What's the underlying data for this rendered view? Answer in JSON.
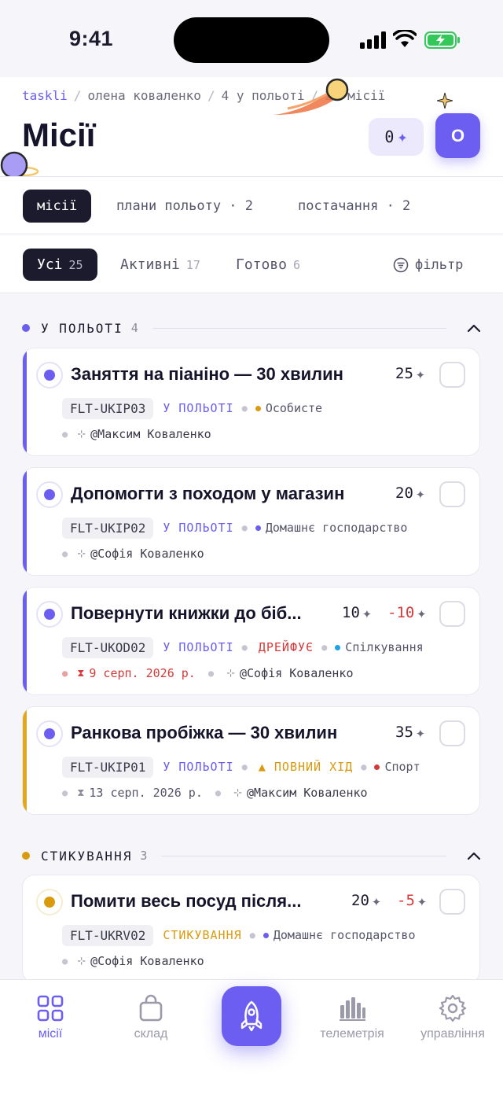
{
  "status_bar": {
    "time": "9:41"
  },
  "breadcrumb": {
    "brand": "taskli",
    "user": "олена коваленко",
    "in_flight": "4 у польоті",
    "missions": "25 місії"
  },
  "header": {
    "title": "Місії",
    "points": "0",
    "points_icon": "spark-icon",
    "avatar_letter": "О"
  },
  "tabs": [
    {
      "label": "місії",
      "active": true
    },
    {
      "label": "плани польоту · 2",
      "active": false
    },
    {
      "label": "постачання · 2",
      "active": false
    }
  ],
  "filters": {
    "all": {
      "label": "Усі",
      "count": "25"
    },
    "active": {
      "label": "Активні",
      "count": "17"
    },
    "done": {
      "label": "Готово",
      "count": "6"
    },
    "filter_label": "фільтр"
  },
  "sections": {
    "flight": {
      "label": "У ПОЛЬОТІ",
      "count": "4",
      "color": "#6b5ef0"
    },
    "dock": {
      "label": "СТИКУВАННЯ",
      "count": "3",
      "color": "#d99a10"
    }
  },
  "cards": [
    {
      "title": "Заняття на піаніно — 30 хвилин",
      "points": "25",
      "code": "FLT-UKIP03",
      "status": "У ПОЛЬОТІ",
      "category": "Особисте",
      "category_color": "#d99a10",
      "assignee": "@Максим Коваленко"
    },
    {
      "title": "Допомогти з походом у магазин",
      "points": "20",
      "code": "FLT-UKIP02",
      "status": "У ПОЛЬОТІ",
      "category": "Домашнє господарство",
      "category_color": "#6b5ef0",
      "assignee": "@Софія Коваленко"
    },
    {
      "title": "Повернути книжки до біб...",
      "points": "10",
      "penalty": "-10",
      "code": "FLT-UKOD02",
      "status": "У ПОЛЬОТІ",
      "flag": "ДРЕЙФУЄ",
      "category": "Спілкування",
      "category_color": "#1aa3e8",
      "due": "9 серп. 2026 р.",
      "assignee": "@Софія Коваленко"
    },
    {
      "title": "Ранкова пробіжка — 30 хвилин",
      "points": "35",
      "code": "FLT-UKIP01",
      "status": "У ПОЛЬОТІ",
      "flag": "▲ ПОВНИЙ ХІД",
      "category": "Спорт",
      "category_color": "#d43a3a",
      "due": "13 серп. 2026 р.",
      "assignee": "@Максим Коваленко"
    },
    {
      "title": "Помити весь посуд після...",
      "points": "20",
      "penalty": "-5",
      "code": "FLT-UKRV02",
      "status": "СТИКУВАННЯ",
      "category": "Домашнє господарство",
      "category_color": "#6b5ef0",
      "assignee": "@Софія Коваленко"
    }
  ],
  "bottom_nav": {
    "missions": "місії",
    "storage": "склад",
    "telemetry": "телеметрія",
    "control": "управління"
  },
  "colors": {
    "accent": "#6b5ef0",
    "dark": "#1c1b2e",
    "warning": "#d99a10",
    "danger": "#d43a3a"
  }
}
